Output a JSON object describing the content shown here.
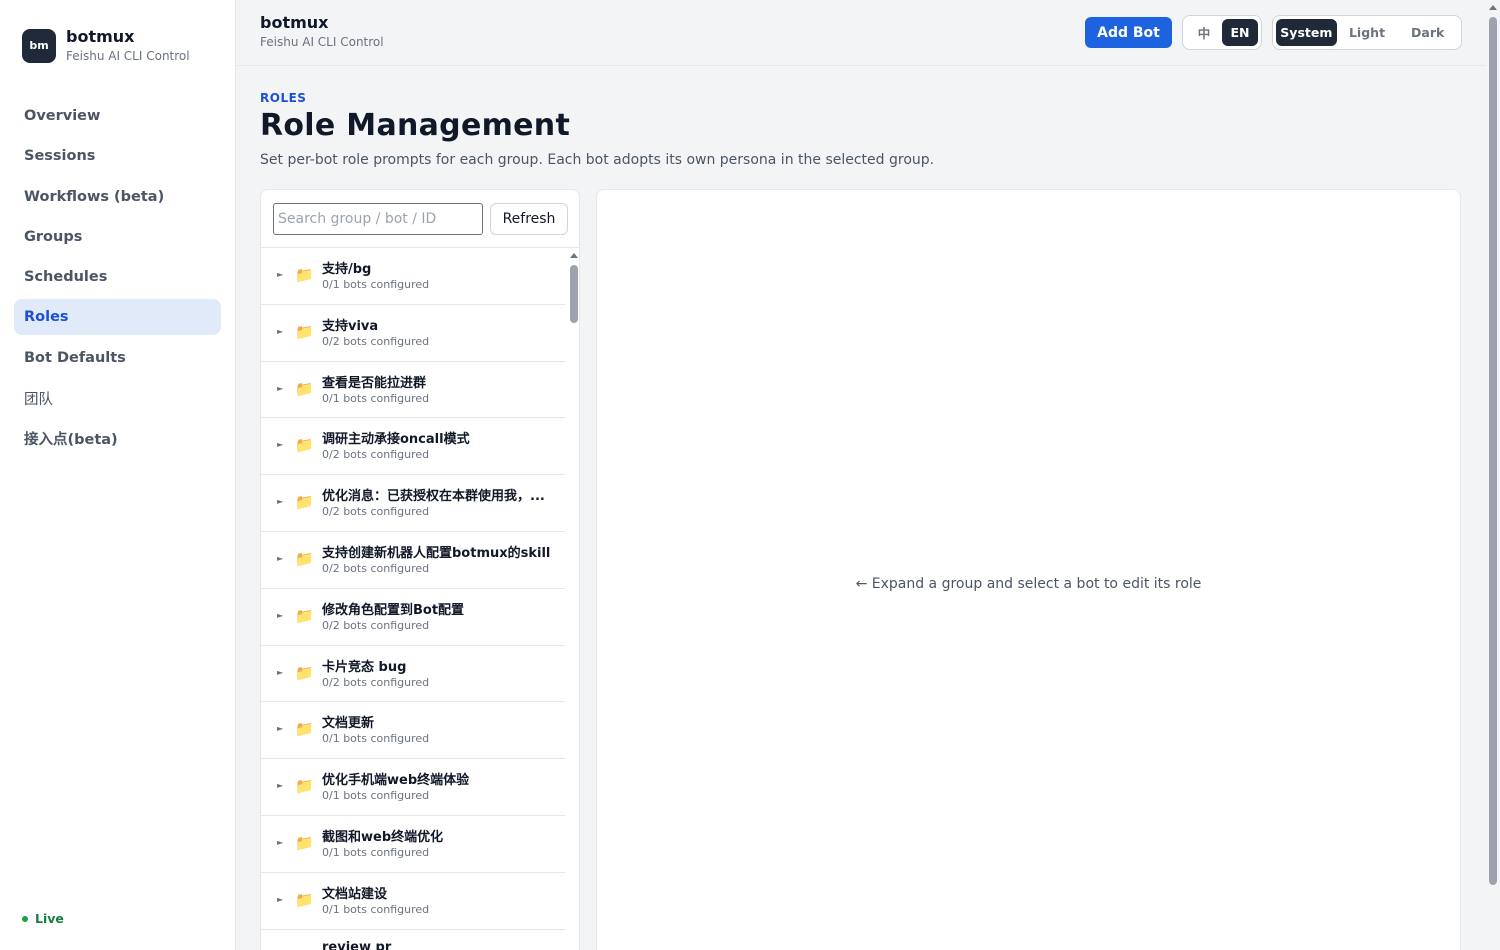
{
  "brand": {
    "logo": "bm",
    "name": "botmux",
    "subtitle": "Feishu AI CLI Control"
  },
  "nav": {
    "overview": "Overview",
    "sessions": "Sessions",
    "workflows": "Workflows (beta)",
    "groups": "Groups",
    "schedules": "Schedules",
    "roles": "Roles",
    "bot_defaults": "Bot Defaults",
    "team": "团队",
    "access_points": "接入点(beta)"
  },
  "status": {
    "live": "Live",
    "live_color": "#16a34a"
  },
  "topbar": {
    "title": "botmux",
    "subtitle": "Feishu AI CLI Control",
    "add_bot": "Add Bot",
    "lang_zh": "中",
    "lang_en": "EN",
    "lang_selected": "EN",
    "theme_system": "System",
    "theme_light": "Light",
    "theme_dark": "Dark",
    "theme_selected": "System"
  },
  "page": {
    "crumb": "ROLES",
    "title": "Role Management",
    "description": "Set per-bot role prompts for each group. Each bot adopts its own persona in the selected group."
  },
  "search": {
    "placeholder": "Search group / bot / ID",
    "value": "",
    "refresh": "Refresh"
  },
  "groups": [
    {
      "name": "支持/bg",
      "count": "0/1 bots configured"
    },
    {
      "name": "支持viva",
      "count": "0/2 bots configured"
    },
    {
      "name": "查看是否能拉进群",
      "count": "0/1 bots configured"
    },
    {
      "name": "调研主动承接oncall模式",
      "count": "0/2 bots configured"
    },
    {
      "name": "优化消息：已获授权在本群使用我，...",
      "count": "0/2 bots configured"
    },
    {
      "name": "支持创建新机器人配置botmux的skill",
      "count": "0/2 bots configured"
    },
    {
      "name": "修改角色配置到Bot配置",
      "count": "0/2 bots configured"
    },
    {
      "name": "卡片竞态 bug",
      "count": "0/2 bots configured"
    },
    {
      "name": "文档更新",
      "count": "0/1 bots configured"
    },
    {
      "name": "优化手机端web终端体验",
      "count": "0/1 bots configured"
    },
    {
      "name": "截图和web终端优化",
      "count": "0/1 bots configured"
    },
    {
      "name": "文档站建设",
      "count": "0/1 bots configured"
    },
    {
      "name": "review pr",
      "count": ""
    }
  ],
  "detail": {
    "empty_message": "← Expand a group and select a bot to edit its role"
  },
  "colors": {
    "accent": "#1d63e0",
    "active_nav_bg": "#e0eaf8",
    "active_nav_text": "#1d4ed8"
  },
  "icons": {
    "group_row": "folder-icon",
    "expand": "caret-right-icon"
  }
}
